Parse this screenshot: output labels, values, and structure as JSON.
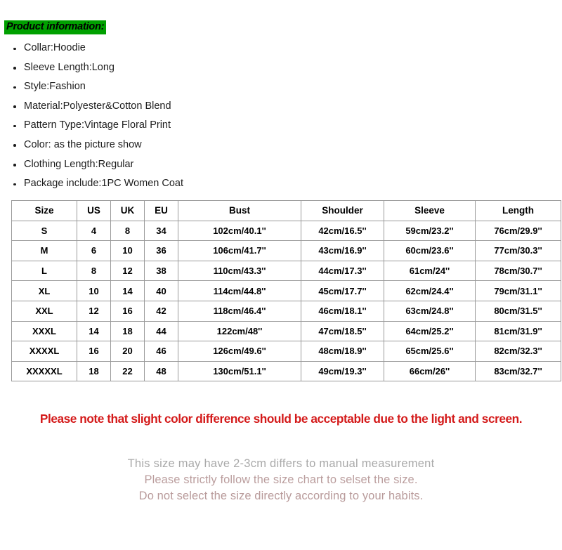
{
  "heading": {
    "text": "Product information:",
    "highlight_color": "#00a000",
    "text_color": "#000000"
  },
  "product_info": {
    "items": [
      "Collar:Hoodie",
      "Sleeve Length:Long",
      "Style:Fashion",
      "Material:Polyester&Cotton Blend",
      "Pattern Type:Vintage Floral Print",
      "Color: as the picture show",
      "Clothing Length:Regular",
      "Package include:1PC Women Coat"
    ]
  },
  "size_table": {
    "headers": [
      "Size",
      "US",
      "UK",
      "EU",
      "Bust",
      "Shoulder",
      "Sleeve",
      "Length"
    ],
    "rows": [
      [
        "S",
        "4",
        "8",
        "34",
        "102cm/40.1''",
        "42cm/16.5''",
        "59cm/23.2''",
        "76cm/29.9''"
      ],
      [
        "M",
        "6",
        "10",
        "36",
        "106cm/41.7''",
        "43cm/16.9''",
        "60cm/23.6''",
        "77cm/30.3''"
      ],
      [
        "L",
        "8",
        "12",
        "38",
        "110cm/43.3''",
        "44cm/17.3''",
        "61cm/24''",
        "78cm/30.7''"
      ],
      [
        "XL",
        "10",
        "14",
        "40",
        "114cm/44.8''",
        "45cm/17.7''",
        "62cm/24.4''",
        "79cm/31.1''"
      ],
      [
        "XXL",
        "12",
        "16",
        "42",
        "118cm/46.4''",
        "46cm/18.1''",
        "63cm/24.8''",
        "80cm/31.5''"
      ],
      [
        "XXXL",
        "14",
        "18",
        "44",
        "122cm/48''",
        "47cm/18.5''",
        "64cm/25.2''",
        "81cm/31.9''"
      ],
      [
        "XXXXL",
        "16",
        "20",
        "46",
        "126cm/49.6''",
        "48cm/18.9''",
        "65cm/25.6''",
        "82cm/32.3''"
      ],
      [
        "XXXXXL",
        "18",
        "22",
        "48",
        "130cm/51.1''",
        "49cm/19.3''",
        "66cm/26''",
        "83cm/32.7''"
      ]
    ]
  },
  "red_notice": {
    "text": "Please note that slight color difference should be acceptable due to the light and screen.",
    "color": "#d41a1a"
  },
  "faded_notes": {
    "line1": "This size may have 2-3cm differs to manual measurement",
    "line2": "Please strictly follow the size chart to selset the size.",
    "line3": "Do not select the size directly according to your habits.",
    "line1_color": "#a9a9a9",
    "line2_color": "#bb9e9e",
    "line3_color": "#b89a9a"
  }
}
